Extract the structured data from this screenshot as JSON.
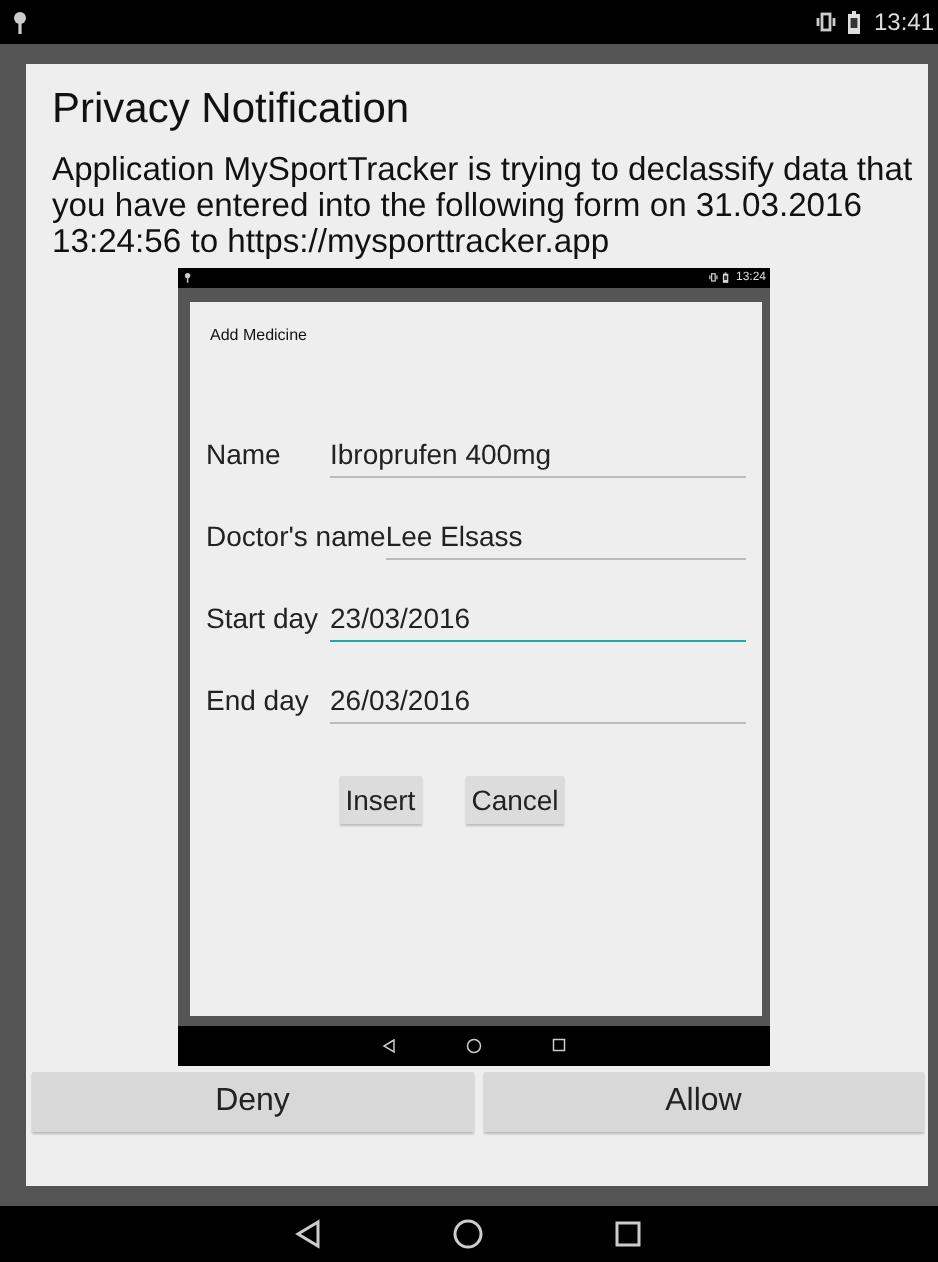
{
  "status_bar": {
    "time": "13:41"
  },
  "dialog": {
    "title": "Privacy Notification",
    "message": "Application MySportTracker is trying to declassify data that you have entered into the following form on 31.03.2016 13:24:56 to https://mysporttracker.app",
    "screenshot": {
      "status_bar": {
        "time": "13:24"
      },
      "form": {
        "title": "Add Medicine",
        "fields": [
          {
            "label": "Name",
            "value": "Ibroprufen 400mg",
            "focused": false
          },
          {
            "label": "Doctor's name",
            "value": "Lee Elsass",
            "focused": false
          },
          {
            "label": "Start day",
            "value": "23/03/2016",
            "focused": true
          },
          {
            "label": "End day",
            "value": "26/03/2016",
            "focused": false
          }
        ],
        "buttons": [
          "Insert",
          "Cancel"
        ]
      }
    },
    "buttons": [
      "Deny",
      "Allow"
    ]
  }
}
